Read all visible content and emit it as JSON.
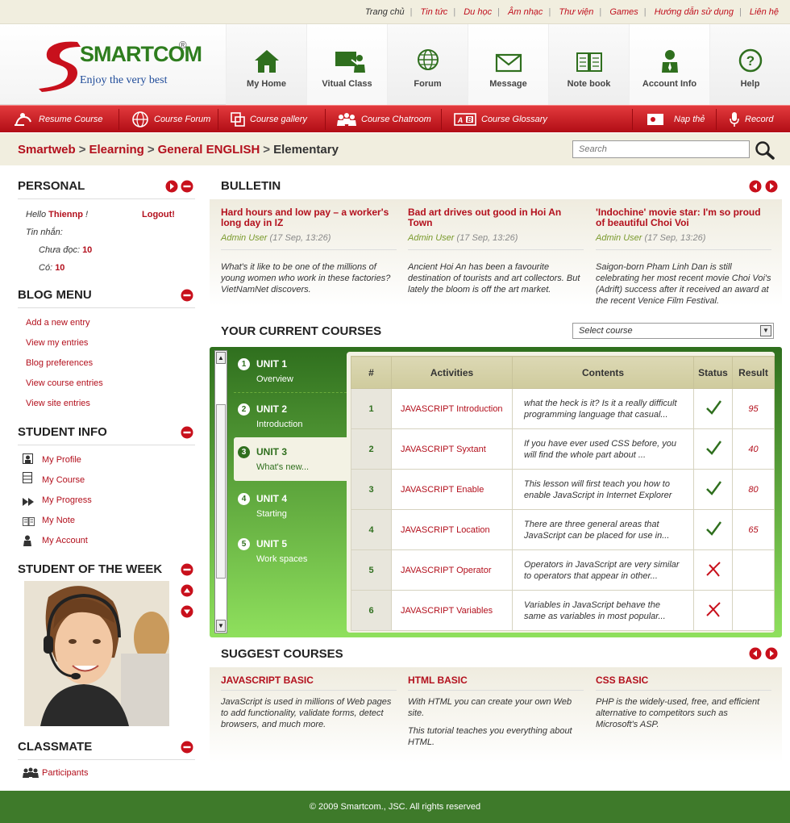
{
  "topnav": [
    "Trang chủ",
    "Tin tức",
    "Du học",
    "Âm nhạc",
    "Thư viện",
    "Games",
    "Hướng dẫn sử dụng",
    "Liên hệ"
  ],
  "logo": {
    "brand": "SMARTCOM",
    "reg": "®",
    "tagline": "Enjoy the very best"
  },
  "mainnav": [
    {
      "label": "My Home",
      "icon": "home-icon"
    },
    {
      "label": "Vitual Class",
      "icon": "virtual-class-icon"
    },
    {
      "label": "Forum",
      "icon": "globe-icon"
    },
    {
      "label": "Message",
      "icon": "envelope-icon"
    },
    {
      "label": "Note book",
      "icon": "notebook-icon"
    },
    {
      "label": "Account Info",
      "icon": "user-icon"
    },
    {
      "label": "Help",
      "icon": "help-icon"
    }
  ],
  "redbar": [
    "Resume Course",
    "Course Forum",
    "Course gallery",
    "Course Chatroom",
    "Course Glossary",
    "Nạp thẻ",
    "Record"
  ],
  "breadcrumb": [
    "Smartweb",
    "Elearning",
    "General ENGLISH",
    "Elementary"
  ],
  "breadcrumb_sep": ">",
  "search": {
    "placeholder": "Search"
  },
  "personal": {
    "title": "PERSONAL",
    "hello": "Hello",
    "user": "Thiennp",
    "excl": "!",
    "logout": "Logout!",
    "messages_label": "Tin nhắn:",
    "unread_label": "Chưa đọc:",
    "unread_count": "10",
    "total_label": "Có:",
    "total_count": "10"
  },
  "blog_menu": {
    "title": "BLOG MENU",
    "items": [
      "Add a new entry",
      "View my entries",
      "Blog preferences",
      "View course entries",
      "View site entries"
    ]
  },
  "student_info": {
    "title": "STUDENT INFO",
    "items": [
      "My Profile",
      "My Course",
      "My Progress",
      "My Note",
      "My Account"
    ]
  },
  "student_week": {
    "title": "STUDENT OF THE WEEK"
  },
  "classmate": {
    "title": "CLASSMATE",
    "item": "Participants"
  },
  "bulletin": {
    "title": "BULLETIN",
    "items": [
      {
        "title": "Hard hours and low pay – a worker's long day in IZ",
        "author": "Admin User",
        "date": "(17 Sep, 13:26)",
        "text": "What's it like to be one of the millions of young women who work in these factories? VietNamNet discovers."
      },
      {
        "title": "Bad art drives out good in Hoi An Town",
        "author": "Admin User",
        "date": "(17 Sep, 13:26)",
        "text": "Ancient Hoi An has been a favourite destination of tourists and art collectors. But lately the bloom is off the art market."
      },
      {
        "title": "'Indochine' movie star: I'm so proud of beautiful Choi Voi",
        "author": "Admin User",
        "date": "(17 Sep, 13:26)",
        "text": "Saigon-born Pham Linh Dan is still celebrating her most recent movie Choi Voi's (Adrift) success after it received an award at the recent Venice Film Festival."
      }
    ]
  },
  "current_courses": {
    "title": "YOUR CURRENT COURSES",
    "select_placeholder": "Select course",
    "units": [
      {
        "num": "1",
        "title": "UNIT 1",
        "sub": "Overview"
      },
      {
        "num": "2",
        "title": "UNIT 2",
        "sub": "Introduction"
      },
      {
        "num": "3",
        "title": "UNIT 3",
        "sub": "What's new..."
      },
      {
        "num": "4",
        "title": "UNIT 4",
        "sub": "Starting"
      },
      {
        "num": "5",
        "title": "UNIT 5",
        "sub": "Work spaces"
      }
    ],
    "columns": [
      "#",
      "Activities",
      "Contents",
      "Status",
      "Result"
    ],
    "rows": [
      {
        "n": "1",
        "activity": "JAVASCRIPT Introduction",
        "content": "what the heck is it? Is it a really difficult programming language that casual...",
        "status": "done",
        "result": "95"
      },
      {
        "n": "2",
        "activity": "JAVASCRIPT Syxtant",
        "content": "If you have ever used CSS before, you will find the whole part about ...",
        "status": "done",
        "result": "40"
      },
      {
        "n": "3",
        "activity": "JAVASCRIPT Enable",
        "content": "This lesson will first teach you how to enable JavaScript in Internet Explorer",
        "status": "done",
        "result": "80"
      },
      {
        "n": "4",
        "activity": "JAVASCRIPT Location",
        "content": "There are three general areas that JavaScript can be placed for use in...",
        "status": "done",
        "result": "65"
      },
      {
        "n": "5",
        "activity": "JAVASCRIPT Operator",
        "content": "Operators in JavaScript are very similar to operators that appear in other...",
        "status": "fail",
        "result": ""
      },
      {
        "n": "6",
        "activity": "JAVASCRIPT Variables",
        "content": "Variables in JavaScript behave the same as variables in most popular...",
        "status": "fail",
        "result": ""
      }
    ]
  },
  "suggest": {
    "title": "SUGGEST COURSES",
    "items": [
      {
        "title": "JAVASCRIPT BASIC",
        "text": "JavaScript is used in millions of Web pages to add functionality, validate forms, detect browsers, and much more.",
        "text2": ""
      },
      {
        "title": "HTML BASIC",
        "text": "With HTML you can create your own Web site.",
        "text2": "This tutorial teaches you everything about HTML."
      },
      {
        "title": "CSS BASIC",
        "text": "PHP is the widely-used, free, and efficient alternative to competitors such as Microsoft's ASP.",
        "text2": ""
      }
    ]
  },
  "footer": "© 2009 Smartcom., JSC. All rights reserved",
  "colors": {
    "brand_red": "#b3101d",
    "brand_green": "#2f6f1e",
    "footer_green": "#3e7a2a"
  }
}
